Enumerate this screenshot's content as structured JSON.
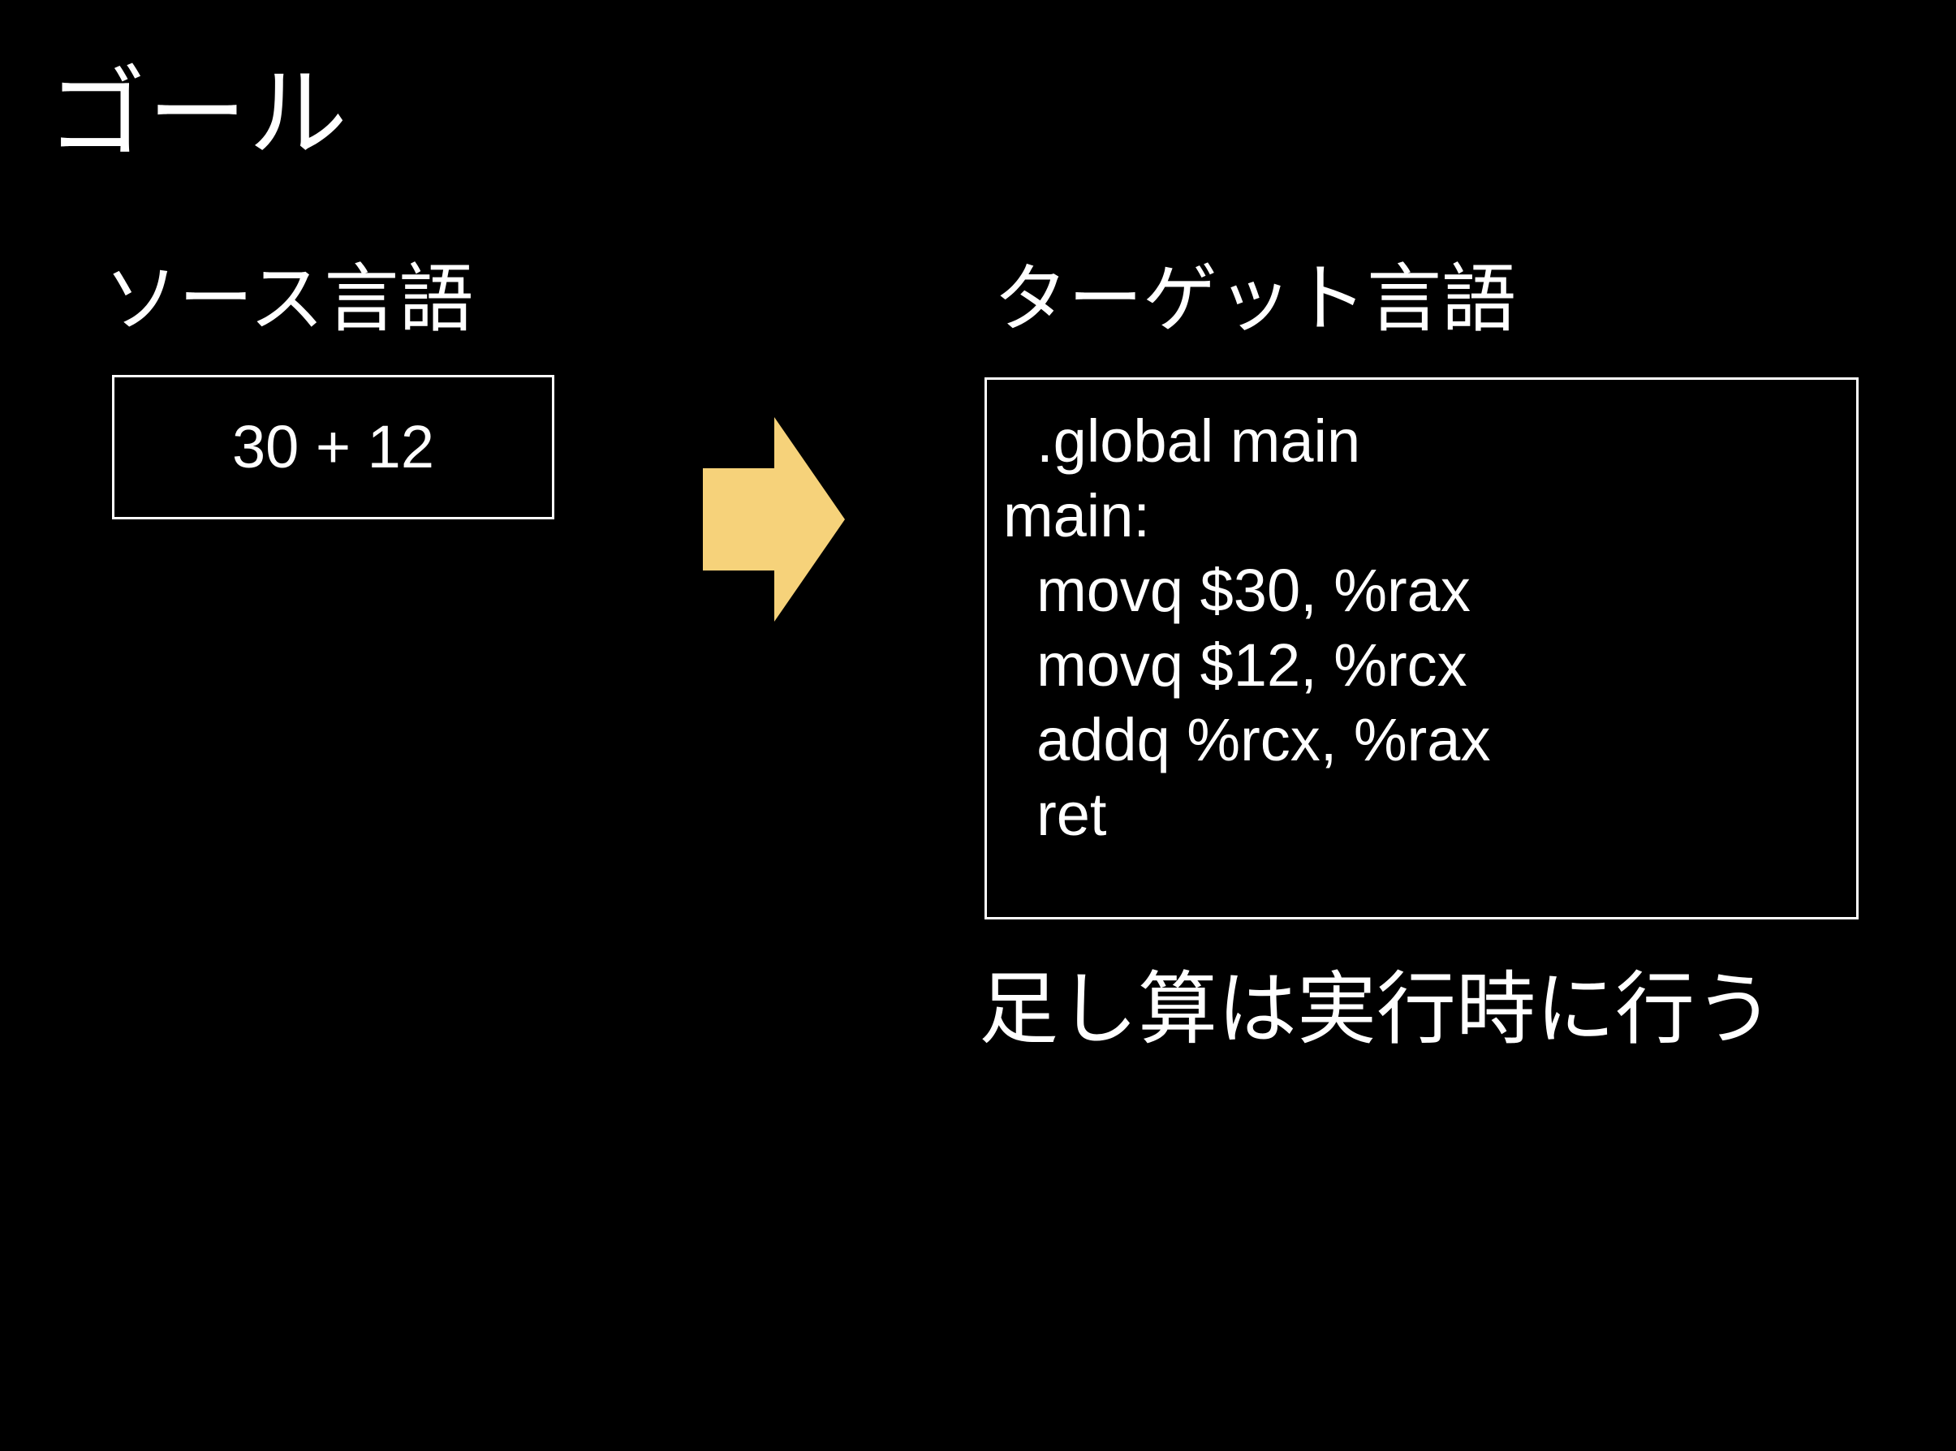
{
  "slide": {
    "title": "ゴール",
    "source": {
      "heading": "ソース言語",
      "code": "30 + 12"
    },
    "target": {
      "heading": "ターゲット言語",
      "code_lines": [
        "  .global main",
        "main:",
        "  movq $30, %rax",
        "  movq $12, %rcx",
        "  addq %rcx, %rax",
        "  ret"
      ]
    },
    "arrow_icon": "right-arrow-icon",
    "footer_note": "足し算は実行時に行う"
  },
  "colors": {
    "background": "#000000",
    "text": "#ffffff",
    "box_border": "#ffffff",
    "arrow_fill": "#f6d27a"
  }
}
